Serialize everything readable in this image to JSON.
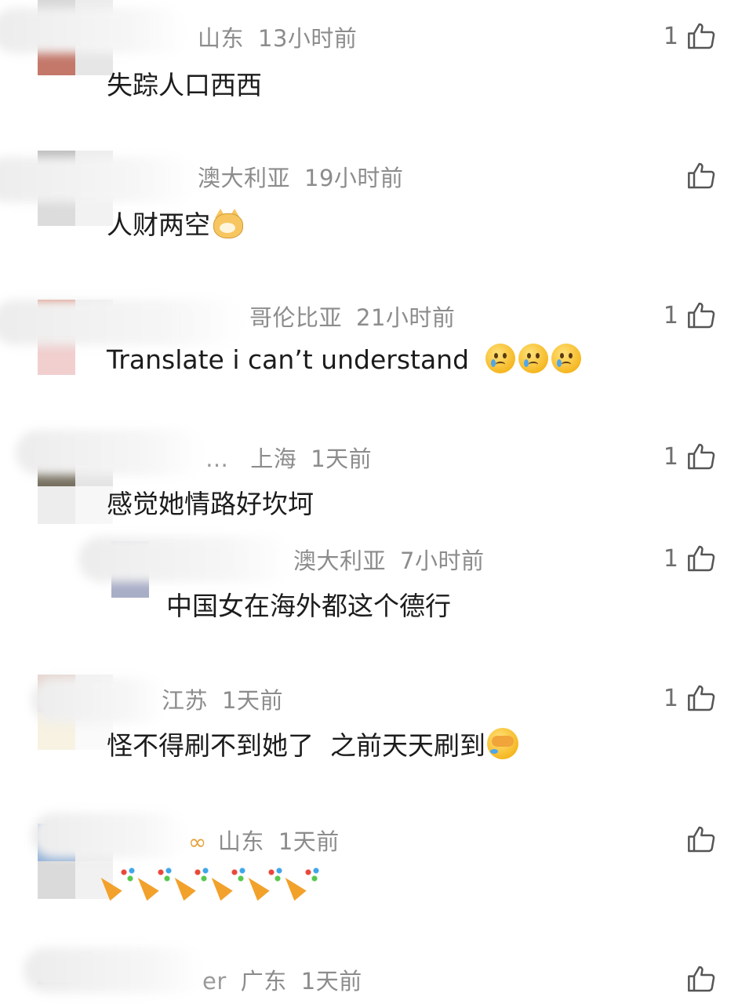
{
  "comments": [
    {
      "region": "山东",
      "time": "13小时前",
      "text": "失踪人口西西",
      "likes": "1",
      "emoji": null
    },
    {
      "region": "澳大利亚",
      "time": "19小时前",
      "text": "人财两空",
      "likes": "",
      "emoji": "cat-face"
    },
    {
      "region": "哥伦比亚",
      "time": "21小时前",
      "text": "Translate i can’t understand",
      "likes": "1",
      "emoji": "crying-face x3"
    },
    {
      "partial_name": "… ",
      "region": "上海",
      "time": "1天前",
      "text": "感觉她情路好坎坷",
      "likes": "1",
      "emoji": null
    },
    {
      "reply": true,
      "region": "澳大利亚",
      "time": "7小时前",
      "text": "中国女在海外都这个德行",
      "likes": "1",
      "emoji": null
    },
    {
      "region": "江苏",
      "time": "1天前",
      "text": "怪不得刷不到她了  之前天天刷到",
      "likes": "1",
      "emoji": "face-covering-tears"
    },
    {
      "region": "山东",
      "time": "1天前",
      "text": "",
      "likes": "",
      "emoji": "party-popper x6"
    },
    {
      "partial_name": "er",
      "region": "广东",
      "time": "1天前",
      "text": "",
      "likes": "",
      "emoji": null
    }
  ],
  "icons": {
    "like": "thumbs-up-icon"
  },
  "colors": {
    "meta": "#8c8c8c",
    "text": "#1c1c1c",
    "count": "#6f6f6f"
  }
}
